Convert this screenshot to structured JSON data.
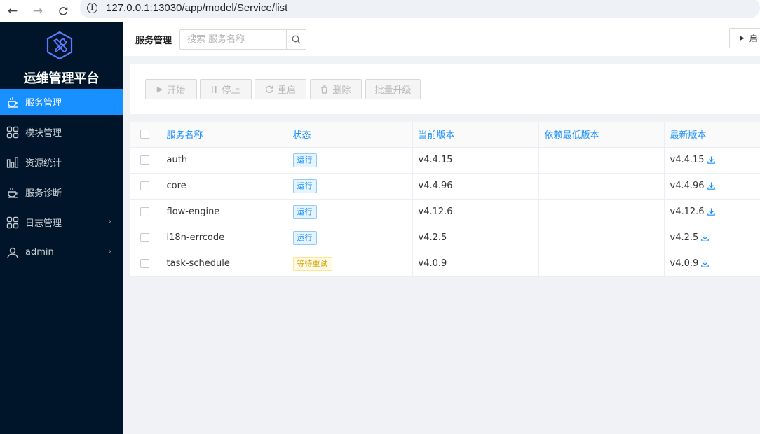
{
  "browser": {
    "url": "127.0.0.1:13030/app/model/Service/list"
  },
  "sidebar": {
    "brand": "运维管理平台",
    "items": [
      {
        "label": "服务管理",
        "icon": "cup-icon",
        "active": true
      },
      {
        "label": "模块管理",
        "icon": "grid-icon"
      },
      {
        "label": "资源统计",
        "icon": "bar-chart-icon"
      },
      {
        "label": "服务诊断",
        "icon": "cup-icon"
      },
      {
        "label": "日志管理",
        "icon": "grid-icon",
        "has_children": true
      },
      {
        "label": "admin",
        "icon": "user-icon",
        "has_children": true
      }
    ]
  },
  "header": {
    "title": "服务管理",
    "search_placeholder": "搜索 服务名称",
    "right_button_label": "启"
  },
  "toolbar": {
    "start": "开始",
    "stop": "停止",
    "restart": "重启",
    "delete": "删除",
    "batch_upgrade": "批量升级"
  },
  "table": {
    "columns": [
      "服务名称",
      "状态",
      "当前版本",
      "依赖最低版本",
      "最新版本"
    ],
    "rows": [
      {
        "name": "auth",
        "status": "运行",
        "status_type": "running",
        "current": "v4.4.15",
        "min_dep": "",
        "latest": "v4.4.15"
      },
      {
        "name": "core",
        "status": "运行",
        "status_type": "running",
        "current": "v4.4.96",
        "min_dep": "",
        "latest": "v4.4.96"
      },
      {
        "name": "flow-engine",
        "status": "运行",
        "status_type": "running",
        "current": "v4.12.6",
        "min_dep": "",
        "latest": "v4.12.6"
      },
      {
        "name": "i18n-errcode",
        "status": "运行",
        "status_type": "running",
        "current": "v4.2.5",
        "min_dep": "",
        "latest": "v4.2.5"
      },
      {
        "name": "task-schedule",
        "status": "等待重试",
        "status_type": "waiting",
        "current": "v4.0.9",
        "min_dep": "",
        "latest": "v4.0.9"
      }
    ]
  },
  "colors": {
    "sidebar_bg": "#001529",
    "accent": "#1890ff",
    "waiting": "#d4a100"
  }
}
